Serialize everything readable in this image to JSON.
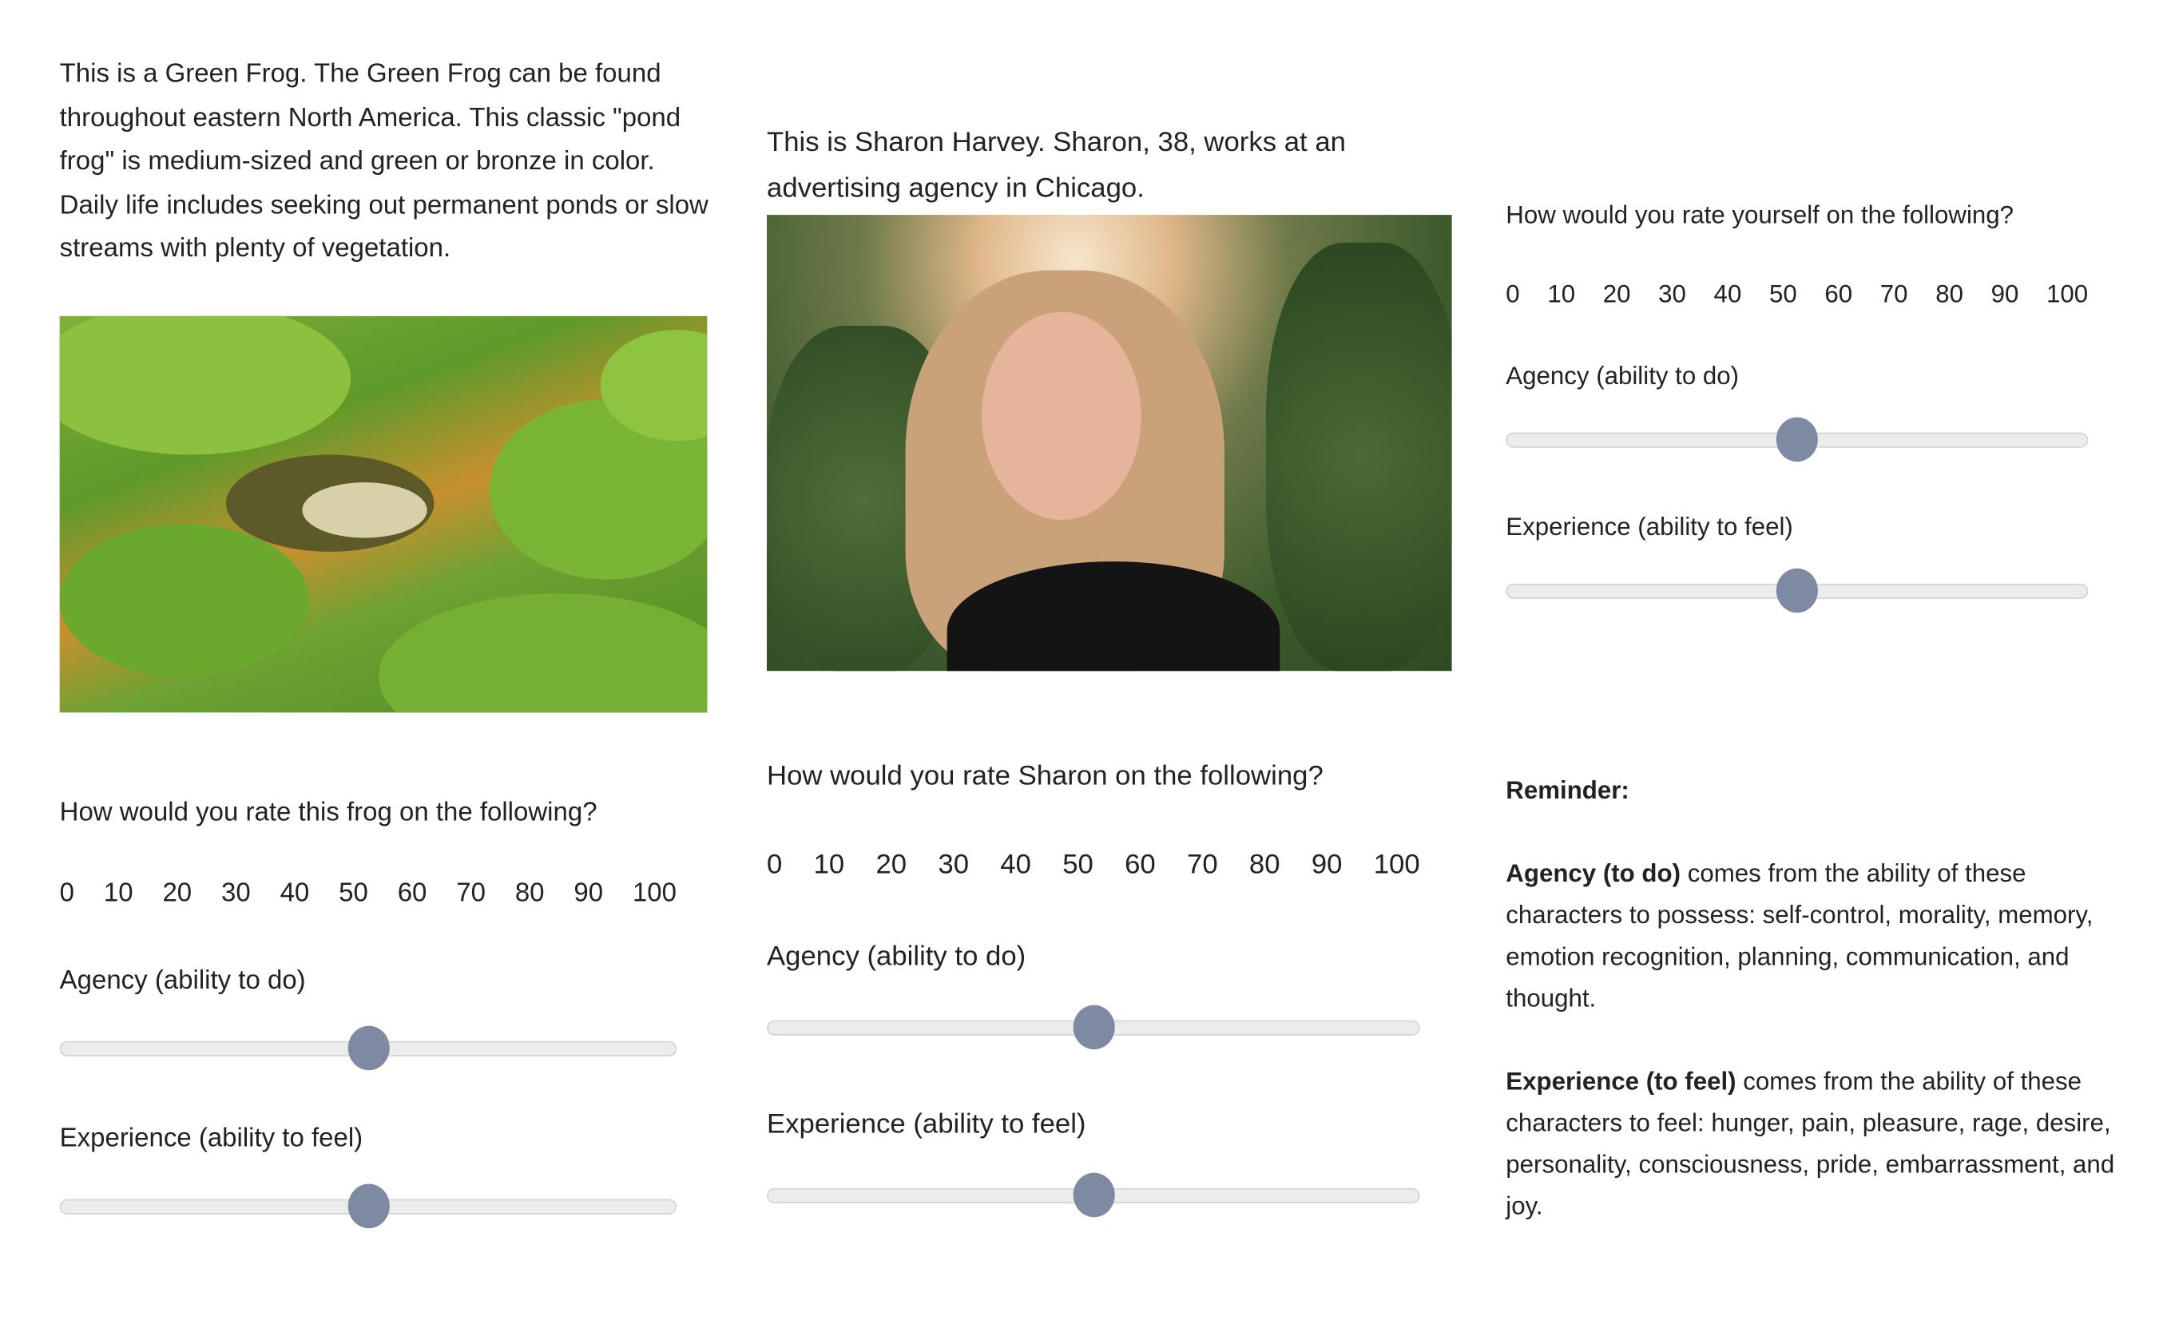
{
  "frog_column": {
    "description": "This is a Green Frog. The Green Frog can be found throughout eastern North America. This classic \"pond frog\" is medium-sized and green or bronze in color. Daily life includes seeking out permanent ponds or slow streams with plenty of vegetation.",
    "image_alt": "green frog on lily pads",
    "question": "How would you rate this frog on the following?",
    "agency_label": "Agency (ability to do)",
    "agency_value": 50,
    "experience_label": "Experience (ability to feel)",
    "experience_value": 50
  },
  "person_column": {
    "description": "This is Sharon Harvey. Sharon, 38, works at an advertising agency in Chicago.",
    "image_alt": "photo of smiling woman",
    "question": "How would you rate Sharon on the following?",
    "agency_label": "Agency (ability to do)",
    "agency_value": 50,
    "experience_label": "Experience (ability to feel)",
    "experience_value": 50
  },
  "self_column": {
    "question": "How would you rate yourself on the following?",
    "agency_label": "Agency (ability to do)",
    "agency_value": 50,
    "experience_label": "Experience (ability to feel)",
    "experience_value": 50
  },
  "scale_ticks": [
    "0",
    "10",
    "20",
    "30",
    "40",
    "50",
    "60",
    "70",
    "80",
    "90",
    "100"
  ],
  "reminder": {
    "title": "Reminder:",
    "agency_term": "Agency (to do)",
    "agency_text": " comes from the ability of these characters to possess: self-control, morality, memory, emotion recognition, planning, communication, and thought.",
    "experience_term": "Experience (to feel)",
    "experience_text": " comes from the ability of these characters to feel: hunger, pain, pleasure, rage, desire, personality, consciousness, pride, embarrassment, and joy."
  },
  "colors": {
    "thumb": "#7e8aa2",
    "track": "#ececec"
  }
}
